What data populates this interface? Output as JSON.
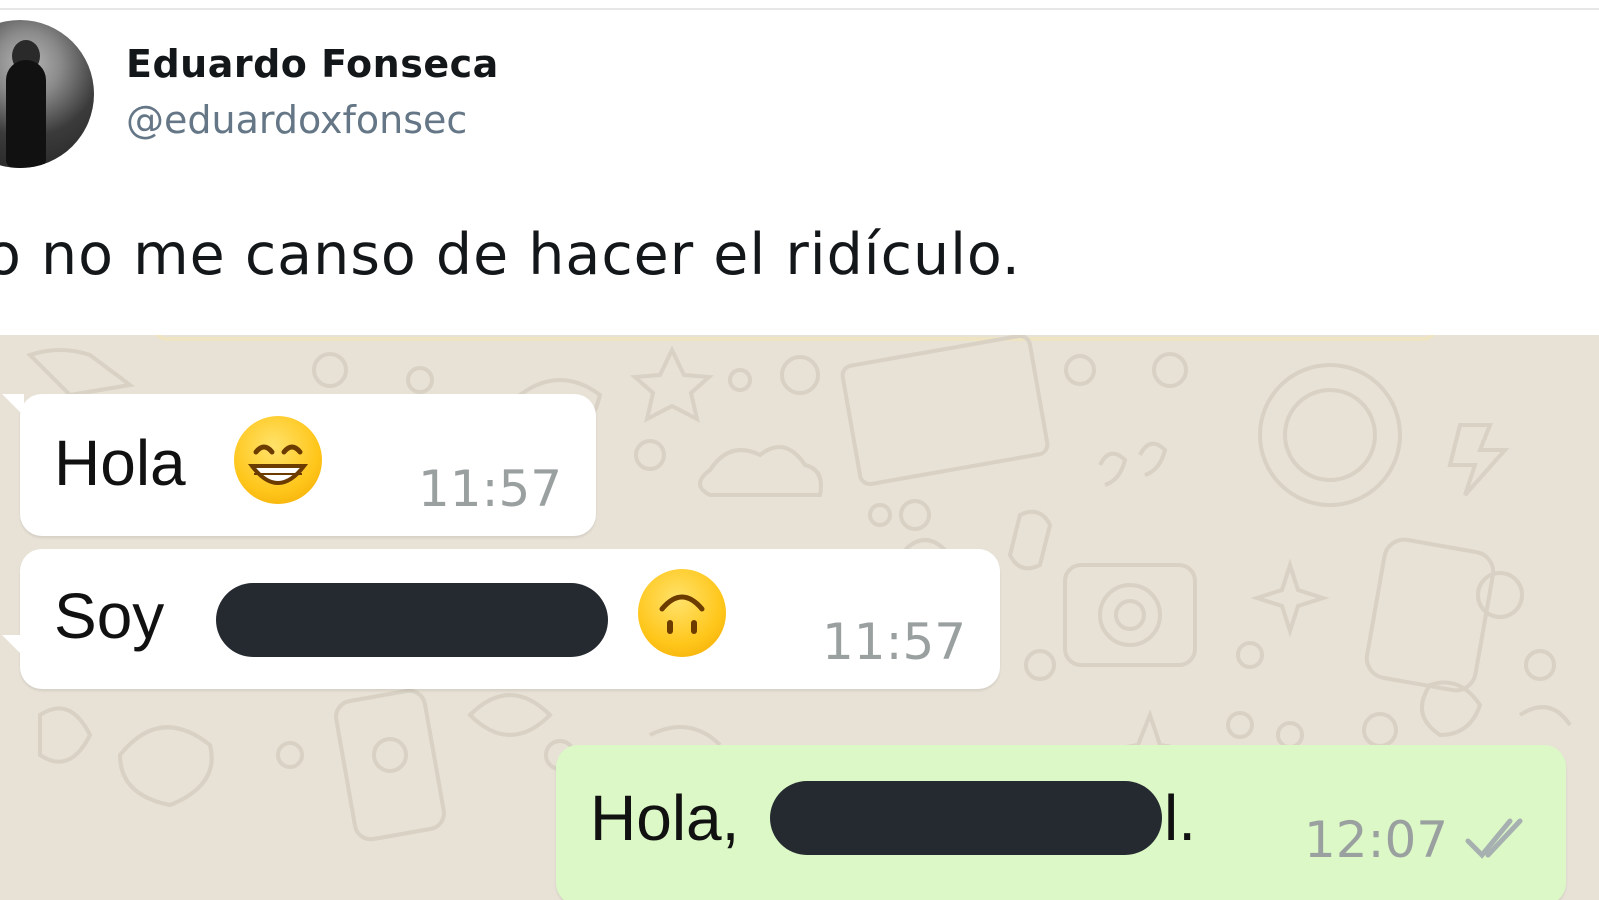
{
  "tweet": {
    "display_name": "Eduardo Fonseca",
    "handle": "@eduardoxfonsec",
    "text": "o no me canso de hacer el ridículo."
  },
  "chat": {
    "messages": [
      {
        "direction": "incoming",
        "text": "Hola",
        "emoji": "grinning-face-with-smiling-eyes",
        "time": "11:57"
      },
      {
        "direction": "incoming",
        "text": "Soy",
        "redacted": true,
        "emoji": "upside-down-face",
        "time": "11:57"
      },
      {
        "direction": "outgoing",
        "text": "Hola,",
        "suffix": "l.",
        "redacted": true,
        "time": "12:07",
        "status": "read-double-check"
      }
    ],
    "colors": {
      "background": "#e7e1d6",
      "incoming_bubble": "#ffffff",
      "outgoing_bubble": "#dcf8c6",
      "time_text": "#9aa0a0"
    }
  }
}
